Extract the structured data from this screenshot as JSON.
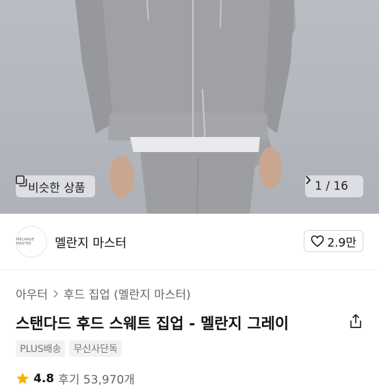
{
  "hero": {
    "similar_button_label": "비슷한 상품",
    "pager_text": "1 / 16"
  },
  "seller": {
    "logo_text": "MELANGE MASTER",
    "name": "멜란지 마스터",
    "like_count": "2.9만"
  },
  "breadcrumb": {
    "category": "아우터",
    "subcategory": "후드 집업 (멜란지 마스터)"
  },
  "product": {
    "title": "스탠다드 후드 스웨트 집업 - 멜란지 그레이"
  },
  "badges": [
    "PLUS배송",
    "무신사단독"
  ],
  "rating": {
    "score": "4.8",
    "review_text": "후기 53,970개"
  },
  "colors": {
    "star": "#f5b400"
  }
}
